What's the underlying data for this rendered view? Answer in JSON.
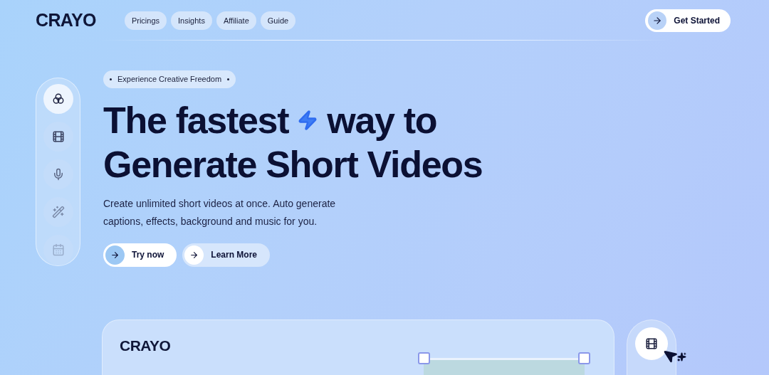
{
  "header": {
    "logo": "CRAYO",
    "nav": [
      "Pricings",
      "Insights",
      "Affiliate",
      "Guide"
    ],
    "cta": "Get Started"
  },
  "sidebar": {
    "items": [
      {
        "selected": true
      },
      {
        "selected": false
      },
      {
        "selected": false
      },
      {
        "selected": false
      },
      {
        "selected": false
      }
    ]
  },
  "hero": {
    "badge": "Experience Creative Freedom",
    "headline_start": "The fastest",
    "headline_end": "way to",
    "headline_line_2": "Generate Short Videos",
    "description": "Create unlimited short videos at once. Auto generate captions, effects, background and music for you.",
    "buttons": [
      {
        "label": "Try now",
        "kind": "primary"
      },
      {
        "label": "Learn More",
        "kind": "secondary"
      }
    ]
  },
  "preview": {
    "logo": "CRAYO"
  }
}
